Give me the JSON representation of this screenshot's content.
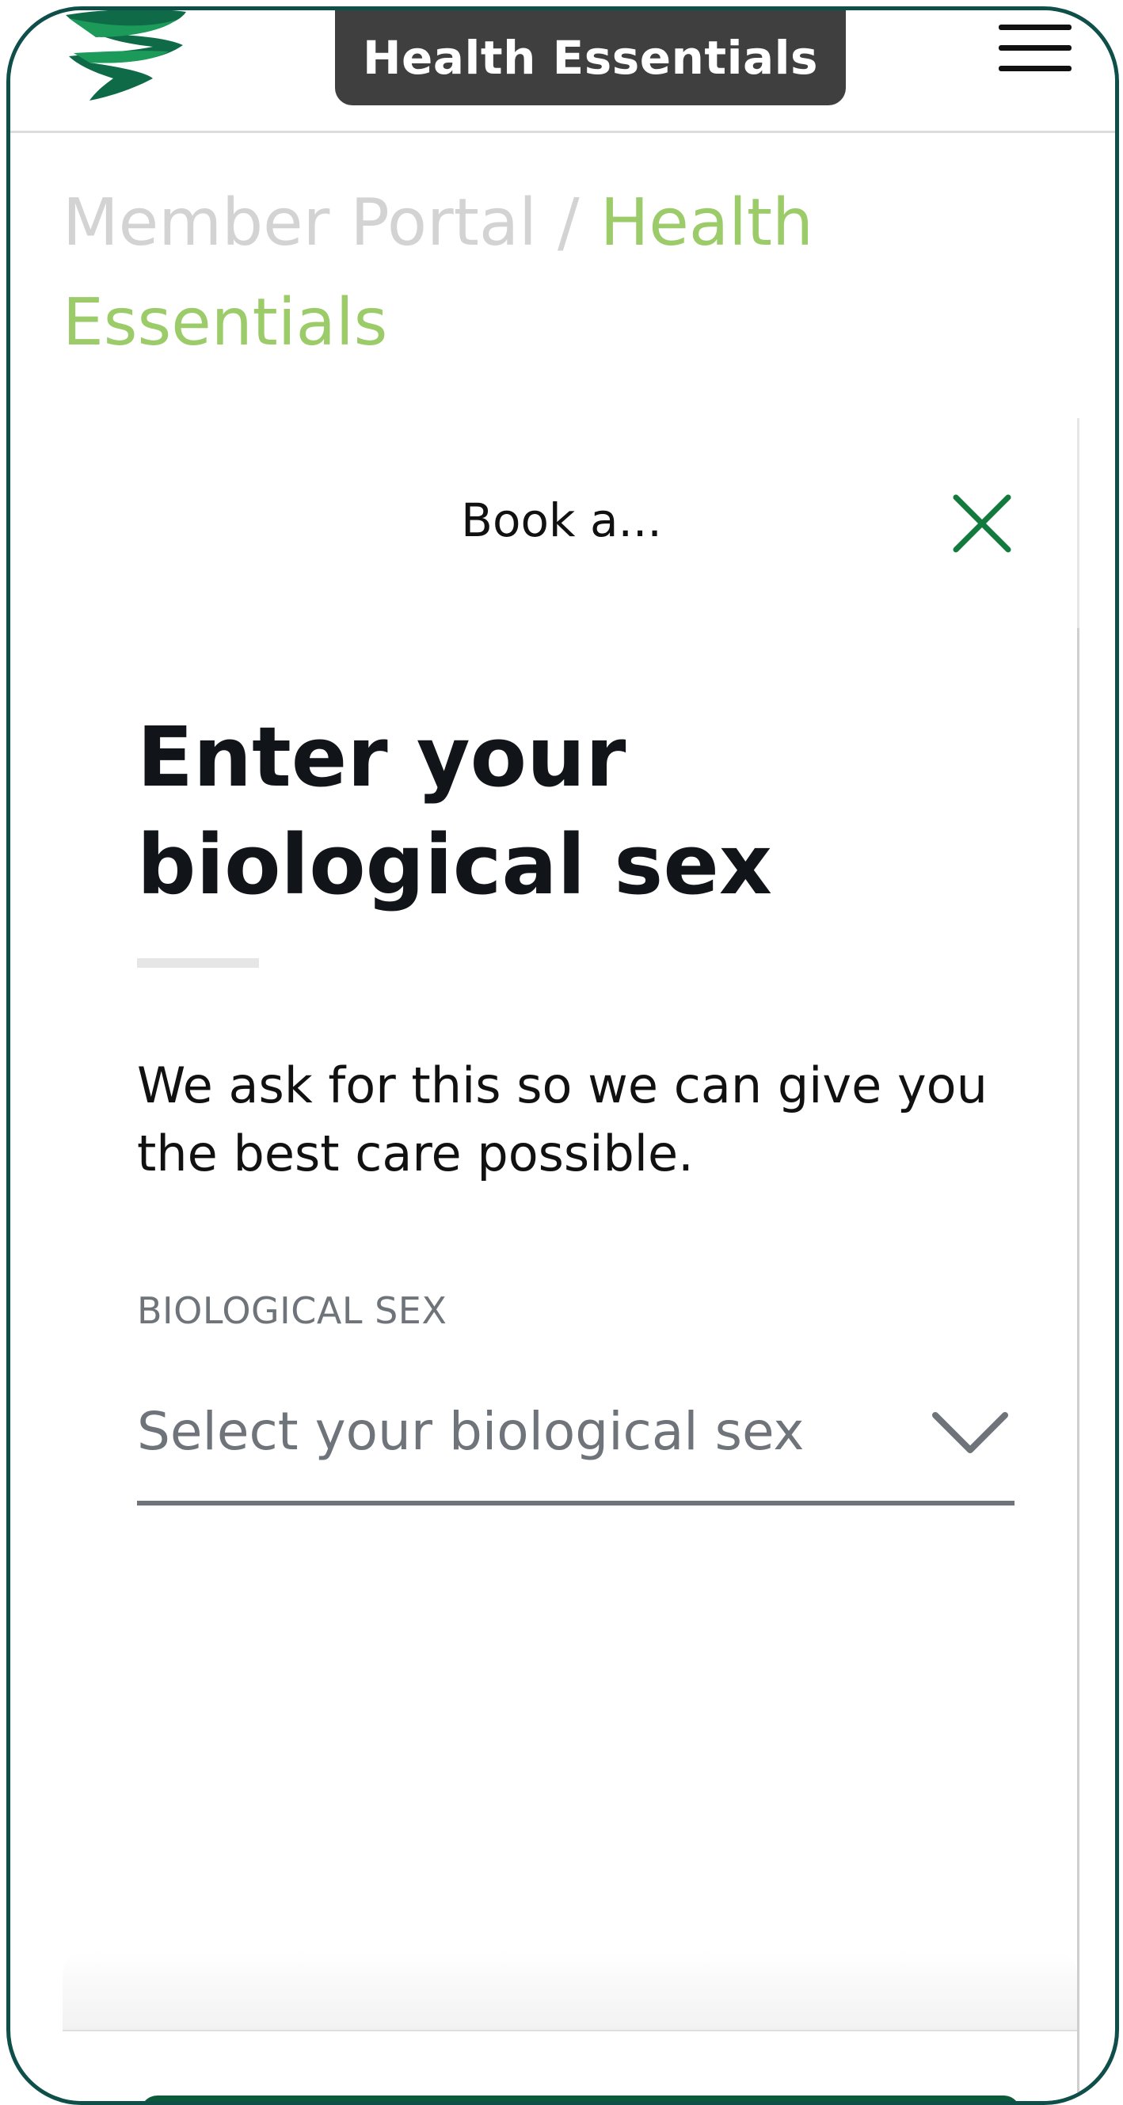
{
  "header": {
    "app_title": "Health Essentials",
    "logo_icon": "brand-ribbon-logo-icon",
    "menu_icon": "hamburger-menu-icon"
  },
  "breadcrumb": {
    "parent": "Member Portal",
    "separator": "/",
    "current": "Health Essentials"
  },
  "modal": {
    "title": "Book a...",
    "close_icon": "close-icon",
    "heading": "Enter your biological sex",
    "description": "We ask for this so we can give you the best care possible.",
    "field": {
      "label": "BIOLOGICAL SEX",
      "placeholder": "Select your biological sex",
      "icon": "chevron-down-icon"
    }
  },
  "colors": {
    "frame": "#0f4f4a",
    "title_pill": "#3f3f3f",
    "breadcrumb_current": "#9ccc6a",
    "breadcrumb_parent": "#d3d3d3",
    "close_icon": "#137a3e",
    "primary_button": "#0d5a3a",
    "input_underline": "#6e747a"
  }
}
